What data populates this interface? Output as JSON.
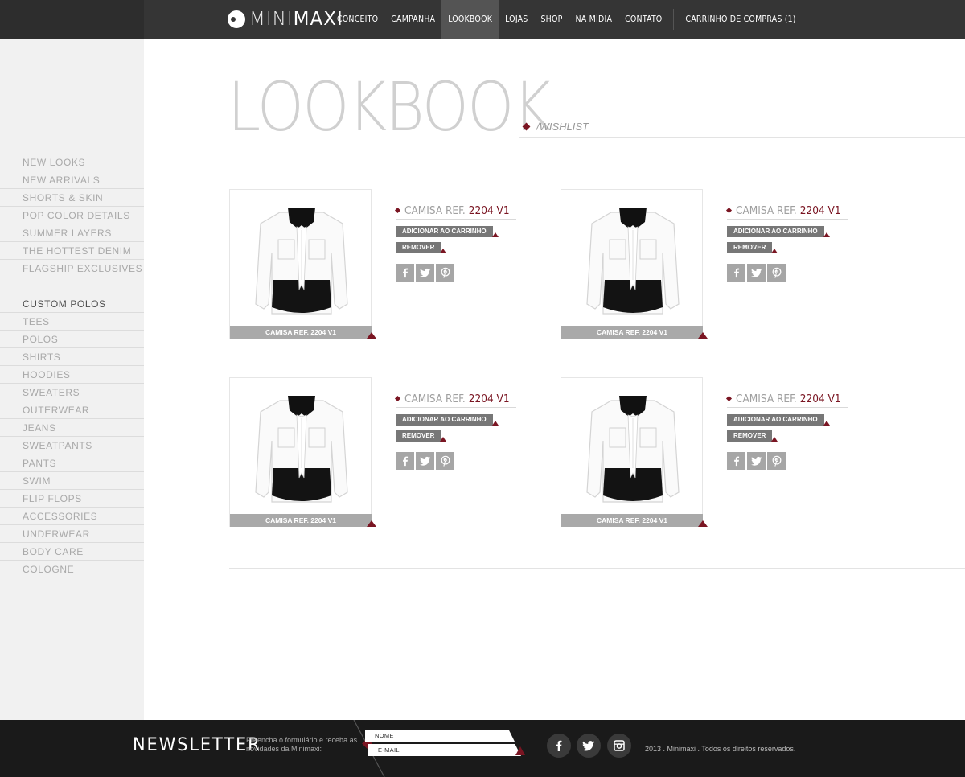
{
  "brand": {
    "logo_part1": "MINI",
    "logo_part2": "MAXI"
  },
  "nav": {
    "items": [
      {
        "label": "CONCEITO",
        "active": false
      },
      {
        "label": "CAMPANHA",
        "active": false
      },
      {
        "label": "LOOKBOOK",
        "active": true
      },
      {
        "label": "LOJAS",
        "active": false
      },
      {
        "label": "SHOP",
        "active": false
      },
      {
        "label": "NA MÍDIA",
        "active": false
      },
      {
        "label": "CONTATO",
        "active": false
      }
    ],
    "cart_label": "CARRINHO DE COMPRAS (1)"
  },
  "sidebar": {
    "collections": [
      "NEW LOOKS",
      "NEW ARRIVALS",
      "SHORTS & SKIN",
      "POP COLOR DETAILS",
      "SUMMER LAYERS",
      "THE HOTTEST DENIM",
      "FLAGSHIP EXCLUSIVES"
    ],
    "categories": [
      "CUSTOM POLOS",
      "TEES",
      "POLOS",
      "SHIRTS",
      "HOODIES",
      "SWEATERS",
      "OUTERWEAR",
      "JEANS",
      "SWEATPANTS",
      "PANTS",
      "SWIM",
      "FLIP FLOPS",
      "ACCESSORIES",
      "UNDERWEAR",
      "BODY CARE",
      "COLOGNE"
    ]
  },
  "page": {
    "title": "LOOKBOOK",
    "subtitle": "/WISHLIST"
  },
  "products": [
    {
      "caption": "CAMISA REF. 2204 V1",
      "name": "CAMISA REF.",
      "ref": "2204 V1",
      "add_label": "ADICIONAR AO CARRINHO",
      "remove_label": "REMOVER"
    },
    {
      "caption": "CAMISA REF. 2204 V1",
      "name": "CAMISA REF.",
      "ref": "2204 V1",
      "add_label": "ADICIONAR AO CARRINHO",
      "remove_label": "REMOVER"
    },
    {
      "caption": "CAMISA REF. 2204 V1",
      "name": "CAMISA REF.",
      "ref": "2204 V1",
      "add_label": "ADICIONAR AO CARRINHO",
      "remove_label": "REMOVER"
    },
    {
      "caption": "CAMISA REF. 2204 V1",
      "name": "CAMISA REF.",
      "ref": "2204 V1",
      "add_label": "ADICIONAR AO CARRINHO",
      "remove_label": "REMOVER"
    }
  ],
  "share_icons": [
    "facebook-icon",
    "twitter-icon",
    "pinterest-icon"
  ],
  "footer": {
    "newsletter_title": "NEWSLETTER",
    "newsletter_desc": "Preencha o formulário e receba as novidades da Minimaxi:",
    "name_placeholder": "NOME",
    "email_placeholder": "E-MAIL",
    "social_icons": [
      "facebook-icon",
      "twitter-icon",
      "instagram-icon"
    ],
    "copyright": "2013 . Minimaxi . Todos os direitos reservados."
  },
  "colors": {
    "accent": "#7a1522",
    "topbar": "#353535",
    "footer": "#1a1a1a",
    "sidebar": "#f1f1f1"
  }
}
